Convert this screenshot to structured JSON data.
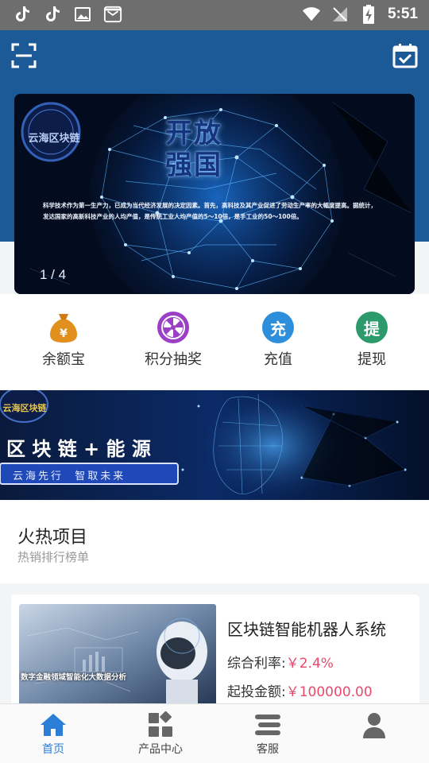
{
  "status_bar": {
    "time": "5:51",
    "left_icons": [
      "tiktok-icon",
      "tiktok-icon",
      "image-icon",
      "inbox-icon"
    ],
    "right_icons": [
      "wifi-icon",
      "no-signal-icon",
      "battery-charging-icon"
    ]
  },
  "header": {
    "scan_icon": "scan-icon",
    "calendar_icon": "calendar-check-icon",
    "bg_color": "#1c5a97"
  },
  "banner": {
    "counter": "1 / 4",
    "logo_text": "云海区块链",
    "headline": "开放强国",
    "body": "科学技术作为第一生产力，已成为当代经济发展的决定因素。首先，高科技及其产业促进了劳动生产率的大幅度提高。据统计，发达国家的高新科技产业的人均产值，是传统工业人均产值的5～10倍，是手工业的50～100倍。"
  },
  "quick_actions": [
    {
      "label": "余额宝",
      "icon": "money-bag-icon",
      "color": "#e2901d"
    },
    {
      "label": "积分抽奖",
      "icon": "lottery-wheel-icon",
      "color": "#9b3fc6"
    },
    {
      "label": "充值",
      "icon": "recharge-icon",
      "color": "#2d8fdc",
      "glyph": "充"
    },
    {
      "label": "提现",
      "icon": "withdraw-icon",
      "color": "#2c9a6a",
      "glyph": "提"
    }
  ],
  "promo": {
    "logo_text": "云海区块链",
    "title": "区 块 链 + 能 源",
    "slogan": "云海先行  智取未来"
  },
  "hot": {
    "title": "火热项目",
    "subtitle": "热销排行榜单"
  },
  "product": {
    "title": "区块链智能机器人系统",
    "image_caption": "数字金融领域智能化大数据分析",
    "rate_label": "综合利率:",
    "rate_value": "￥2.4%",
    "amount_label": "起投金额:",
    "amount_value": "￥100000.00"
  },
  "tabs": [
    {
      "label": "首页",
      "icon": "home-icon",
      "active": true
    },
    {
      "label": "产品中心",
      "icon": "grid-icon",
      "active": false
    },
    {
      "label": "客服",
      "icon": "service-icon",
      "active": false
    },
    {
      "label": "",
      "icon": "user-icon",
      "active": false
    }
  ],
  "colors": {
    "accent": "#2b7ed8",
    "price": "#e94a6b"
  }
}
